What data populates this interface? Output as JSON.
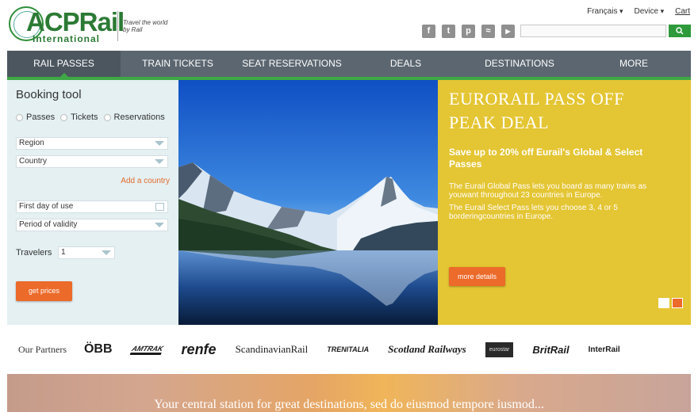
{
  "header": {
    "logo_main": "ACPRail",
    "logo_sub": "International",
    "tagline_line1": "Travel the world",
    "tagline_line2": "by Rail",
    "language": "Français",
    "currency": "Device",
    "cart": "Cart",
    "social_icons": [
      "facebook-icon",
      "twitter-icon",
      "pinterest-icon",
      "rss-icon",
      "youtube-icon"
    ],
    "search_placeholder": ""
  },
  "nav": {
    "items": [
      {
        "label": "RAIL PASSES",
        "active": true
      },
      {
        "label": "TRAIN TICKETS",
        "active": false
      },
      {
        "label": "SEAT RESERVATIONS",
        "active": false
      },
      {
        "label": "DEALS",
        "active": false
      },
      {
        "label": "DESTINATIONS",
        "active": false
      },
      {
        "label": "MORE",
        "active": false
      }
    ]
  },
  "booking": {
    "title": "Booking tool",
    "modes": [
      "Passes",
      "Tickets",
      "Reservations"
    ],
    "region": "Region",
    "country": "Country",
    "add_country": "Add a country",
    "first_day": "First day of use",
    "validity": "Period of validity",
    "travelers_label": "Travelers",
    "travelers_value": "1",
    "get_prices": "get prices"
  },
  "promo": {
    "title": "EURORAIL PASS OFF PEAK DEAL",
    "subtitle": "Save up to 20% off Eurail's Global & Select Passes",
    "body1": "The Eurail Global Pass lets you board as many trains as youwant throughout 23 countries in Europe.",
    "body2": "The Eurail Select Pass lets you choose 3, 4 or 5 borderingcountries in Europe.",
    "button": "more details",
    "colors": {
      "background": "#e4c533",
      "button": "#ec6a2a"
    }
  },
  "partners": {
    "label": "Our Partners",
    "logos": [
      "ÖBB",
      "AMTRAK",
      "renfe",
      "ScandinavianRail",
      "TRENITALIA",
      "Scotland Railways",
      "eurostar",
      "BritRail",
      "InterRail"
    ]
  },
  "banner": {
    "text": "Your central station for great destinations, sed do eiusmod tempore iusmod..."
  }
}
